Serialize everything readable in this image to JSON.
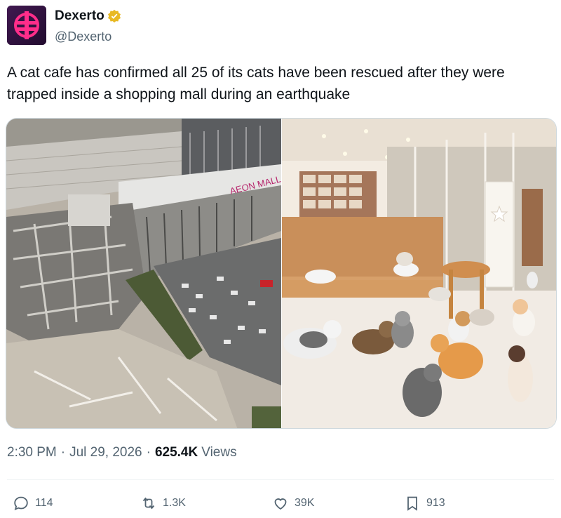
{
  "author": {
    "name": "Dexerto",
    "handle": "@Dexerto",
    "verified_color": "#e8b923"
  },
  "tweet": {
    "text": "A cat cafe has confirmed all 25 of its cats have been rescued after they were trapped inside a shopping mall during an earthquake"
  },
  "media": {
    "left_image": {
      "sign_text": "AEON MALL"
    },
    "right_image": {}
  },
  "meta": {
    "time": "2:30 PM",
    "date": "Jul 29, 2026",
    "views_count": "625.4K",
    "views_label": "Views",
    "separator": "·"
  },
  "actions": {
    "replies": "114",
    "reposts": "1.3K",
    "likes": "39K",
    "bookmarks": "913"
  },
  "colors": {
    "text": "#0f1419",
    "secondary": "#536471",
    "avatar_bg": "#2a0f3a",
    "avatar_accent": "#ff2d8a"
  }
}
